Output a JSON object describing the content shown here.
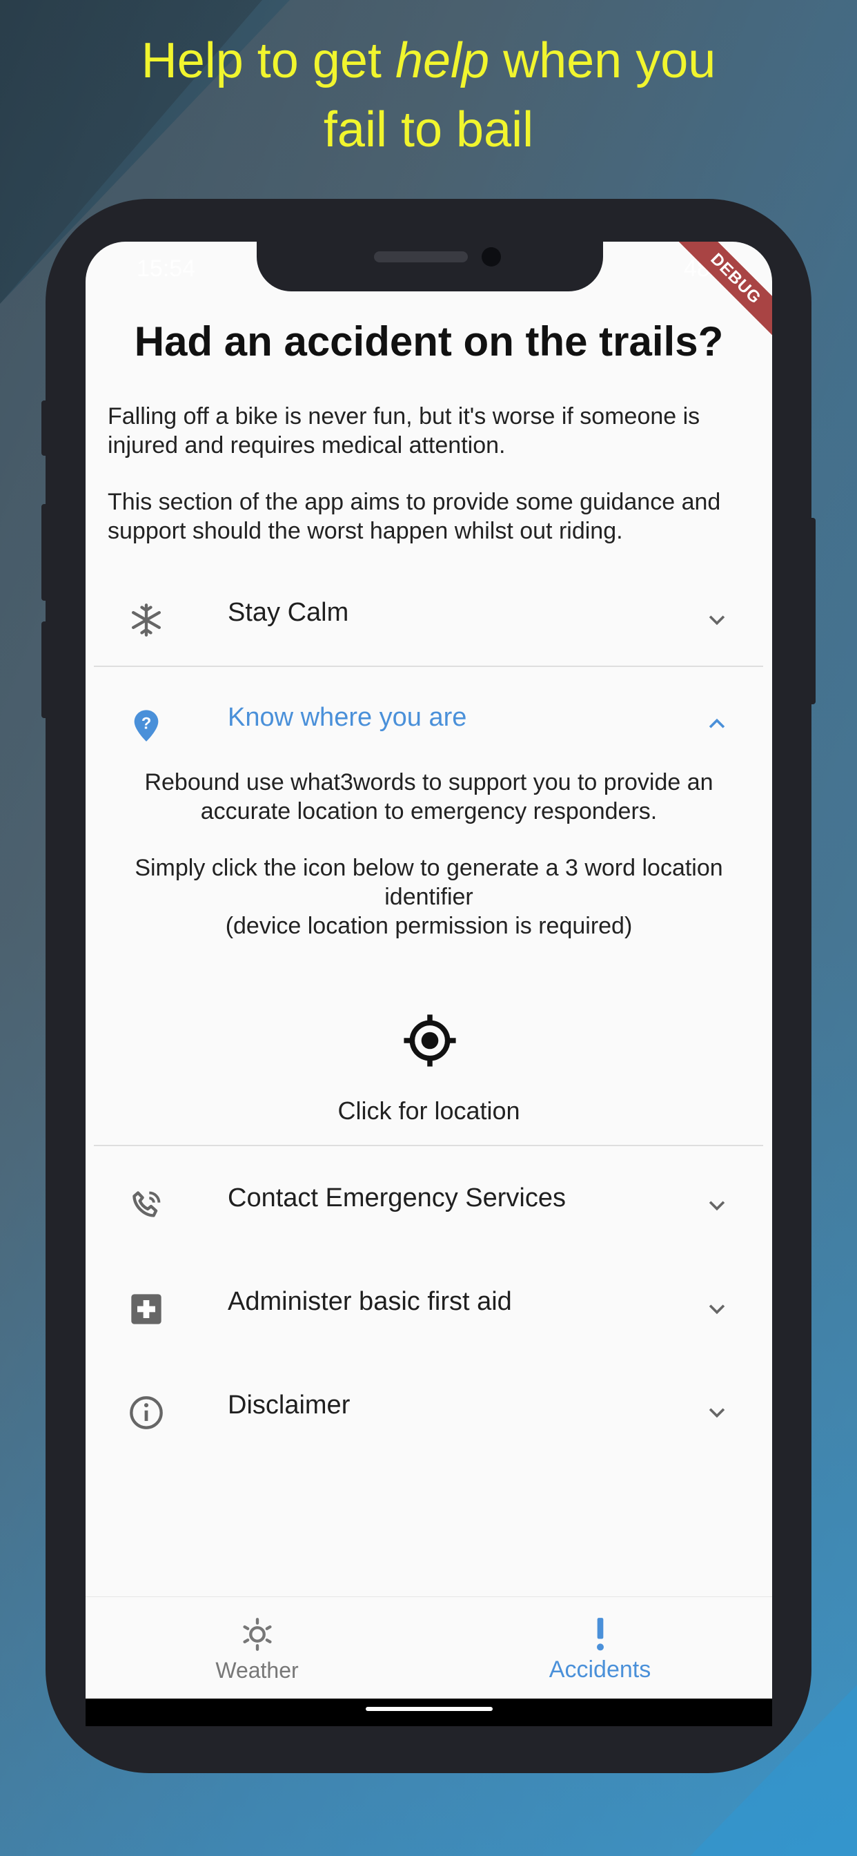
{
  "headline": {
    "part1": "Help to get ",
    "emphasis": "help",
    "part2": " when you",
    "line2": "fail to bail",
    "color": "#f1f52e"
  },
  "status_bar": {
    "time": "15:54",
    "battery": "48%"
  },
  "debug_banner": "DEBUG",
  "page": {
    "title": "Had an accident on the trails?",
    "intro_1": "Falling off a bike is never fun, but it's worse if someone is injured and requires medical attention.",
    "intro_2": "This section of the app aims to provide some guidance and support should the worst happen whilst out riding."
  },
  "sections": [
    {
      "label": "Stay Calm",
      "icon": "snowflake-icon",
      "expanded": false
    },
    {
      "label": "Know where you are",
      "icon": "location-help-icon",
      "expanded": true
    },
    {
      "label": "Contact Emergency Services",
      "icon": "phone-call-icon",
      "expanded": false
    },
    {
      "label": "Administer basic first aid",
      "icon": "first-aid-icon",
      "expanded": false
    },
    {
      "label": "Disclaimer",
      "icon": "info-icon",
      "expanded": false
    }
  ],
  "location_panel": {
    "text_1": "Rebound use what3words to support you to provide an accurate location to emergency responders.",
    "text_2": "Simply click the icon below to generate a 3 word location identifier",
    "text_3": "(device location permission is required)",
    "button_label": "Click for location",
    "icon": "gps-target-icon"
  },
  "bottom_nav": {
    "items": [
      {
        "label": "Weather",
        "icon": "weather-icon",
        "active": false
      },
      {
        "label": "Accidents",
        "icon": "exclamation-icon",
        "active": true
      }
    ]
  },
  "colors": {
    "accent": "#4a90d9",
    "phone_frame": "#222329",
    "debug": "#a94444"
  }
}
